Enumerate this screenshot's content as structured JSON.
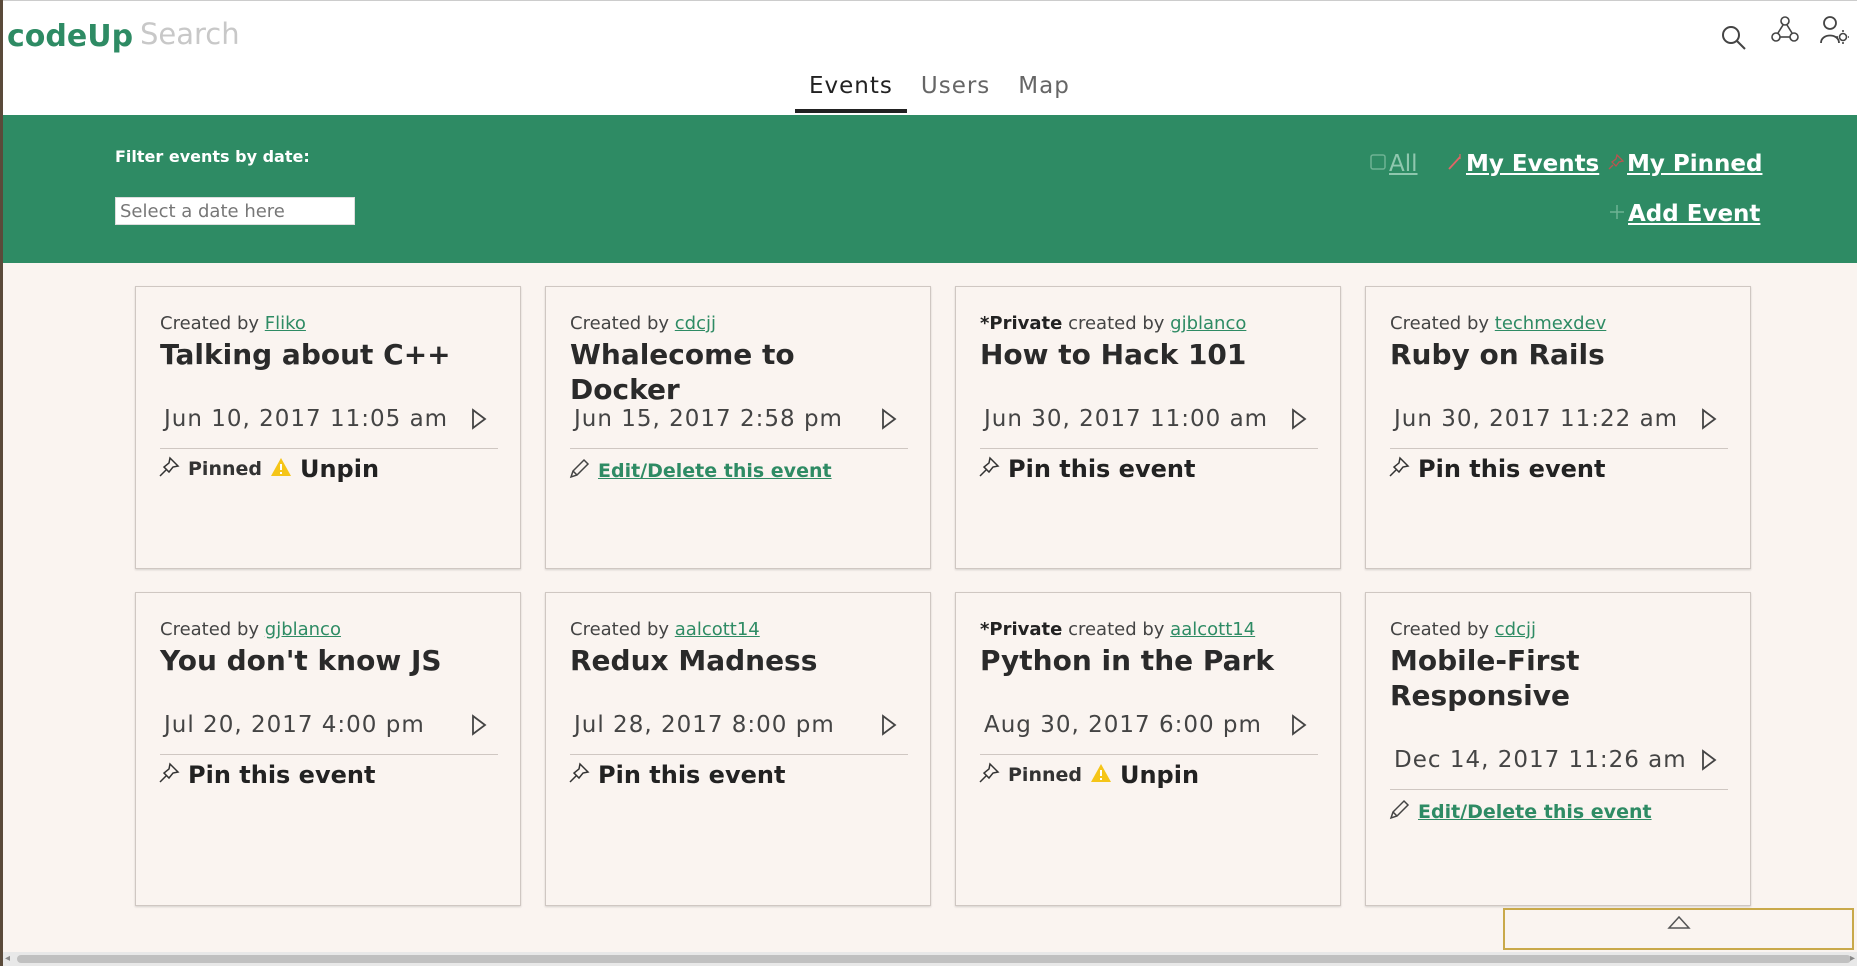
{
  "app": {
    "logo": "codeUp"
  },
  "search": {
    "placeholder": "Search"
  },
  "header_icons": [
    "search-icon",
    "network-icon",
    "user-settings-icon"
  ],
  "tabs": [
    {
      "label": "Events",
      "active": true
    },
    {
      "label": "Users",
      "active": false
    },
    {
      "label": "Map",
      "active": false
    }
  ],
  "filter": {
    "label": "Filter events by date:",
    "date_placeholder": "Select a date here",
    "links": {
      "all": "All",
      "my_events": "My Events",
      "my_pinned": "My Pinned",
      "add_event": "Add Event"
    }
  },
  "colors": {
    "brand": "#2e8b64",
    "background": "#faf4f0",
    "warning": "#f5c518"
  },
  "events": [
    {
      "private": false,
      "prefix": "Created by ",
      "private_label": "",
      "user": "Fliko",
      "title": "Talking about C++",
      "date": "Jun 10, 2017 11:05 am",
      "action": "pinned",
      "pinned_label": "Pinned",
      "unpin_label": "Unpin"
    },
    {
      "private": false,
      "prefix": "Created by ",
      "private_label": "",
      "user": "cdcjj",
      "title": "Whalecome to Docker",
      "date": "Jun 15, 2017 2:58 pm",
      "action": "edit",
      "edit_label": "Edit/Delete this event"
    },
    {
      "private": true,
      "prefix": " created by ",
      "private_label": "*Private",
      "user": "gjblanco",
      "title": "How to Hack 101",
      "date": "Jun 30, 2017 11:00 am",
      "action": "pin",
      "pin_label": "Pin this event"
    },
    {
      "private": false,
      "prefix": "Created by ",
      "private_label": "",
      "user": "techmexdev",
      "title": "Ruby on Rails",
      "date": "Jun 30, 2017 11:22 am",
      "action": "pin",
      "pin_label": "Pin this event"
    },
    {
      "private": false,
      "prefix": "Created by ",
      "private_label": "",
      "user": "gjblanco",
      "title": "You don't know JS",
      "date": "Jul 20, 2017 4:00 pm",
      "action": "pin",
      "pin_label": "Pin this event"
    },
    {
      "private": false,
      "prefix": "Created by ",
      "private_label": "",
      "user": "aalcott14",
      "title": "Redux Madness",
      "date": "Jul 28, 2017 8:00 pm",
      "action": "pin",
      "pin_label": "Pin this event"
    },
    {
      "private": true,
      "prefix": " created by ",
      "private_label": "*Private",
      "user": "aalcott14",
      "title": "Python in the Park",
      "date": "Aug 30, 2017 6:00 pm",
      "action": "pinned",
      "pinned_label": "Pinned",
      "unpin_label": "Unpin"
    },
    {
      "private": false,
      "prefix": "Created by ",
      "private_label": "",
      "user": "cdcjj",
      "title": "Mobile-First Responsive",
      "date": "Dec 14, 2017 11:26 am",
      "action": "edit",
      "edit_label": "Edit/Delete this event"
    }
  ]
}
